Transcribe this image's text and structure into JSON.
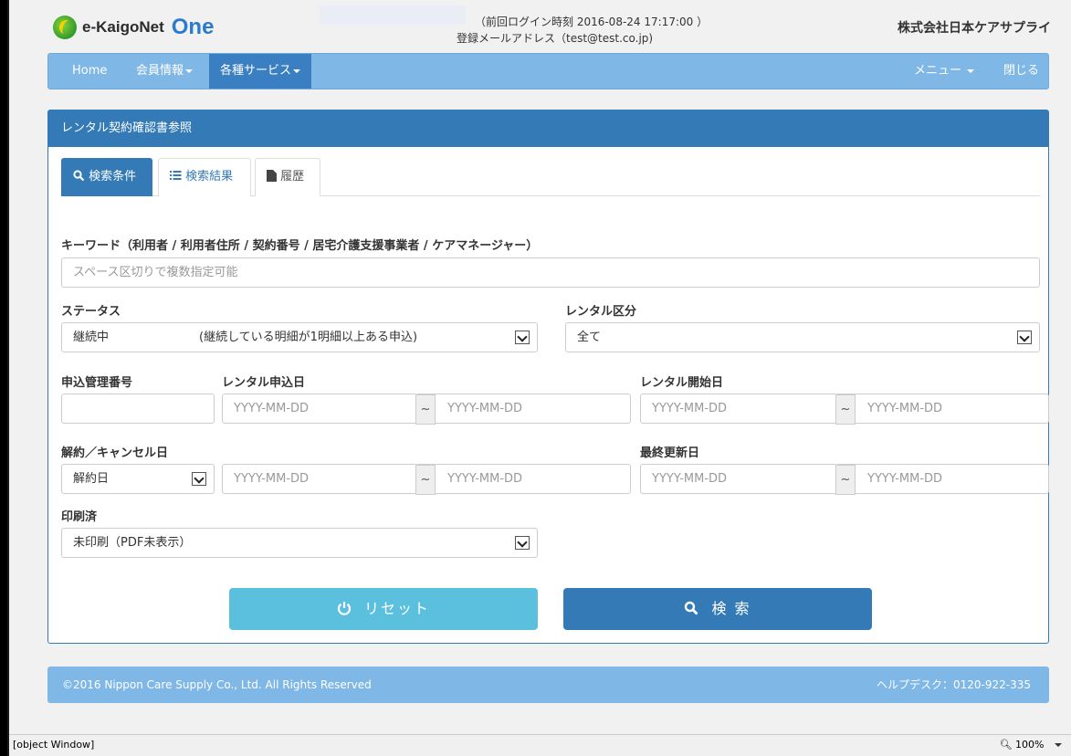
{
  "header": {
    "logo_text": "e-KaigoNet",
    "logo_one": "One",
    "last_login": "（前回ログイン時刻  2016-08-24 17:17:00 ）",
    "email": "登録メールアドレス（test@test.co.jp)",
    "company": "株式会社日本ケアサプライ"
  },
  "nav": {
    "home": "Home",
    "member": "会員情報",
    "services": "各種サービス",
    "menu": "メニュー",
    "close": "閉じる"
  },
  "panel": {
    "title": "レンタル契約確認書参照",
    "tabs": [
      "検索条件",
      "検索結果",
      "履歴"
    ]
  },
  "form": {
    "keyword_label": "キーワード（利用者 / 利用者住所 / 契約番号 / 居宅介護支援事業者 / ケアマネージャー）",
    "keyword_placeholder": "スペース区切りで複数指定可能",
    "status_label": "ステータス",
    "status_value": "継続中",
    "status_note": "(継続している明細が1明細以上ある申込)",
    "rental_type_label": "レンタル区分",
    "rental_type_value": "全て",
    "app_no_label": "申込管理番号",
    "app_date_label": "レンタル申込日",
    "start_date_label": "レンタル開始日",
    "cancel_label": "解約／キャンセル日",
    "cancel_select": "解約日",
    "updated_label": "最終更新日",
    "printed_label": "印刷済",
    "printed_value": "未印刷（PDF未表示）",
    "date_placeholder": "YYYY-MM-DD",
    "tilde": "~",
    "reset": "リセット",
    "search": "検 索"
  },
  "footer": {
    "copyright": "©2016 Nippon Care Supply Co., Ltd. All Rights Reserved",
    "helpdesk": "ヘルプデスク：0120-922-335"
  },
  "statusbar": {
    "left": "[object Window]",
    "zoom": "100%"
  }
}
